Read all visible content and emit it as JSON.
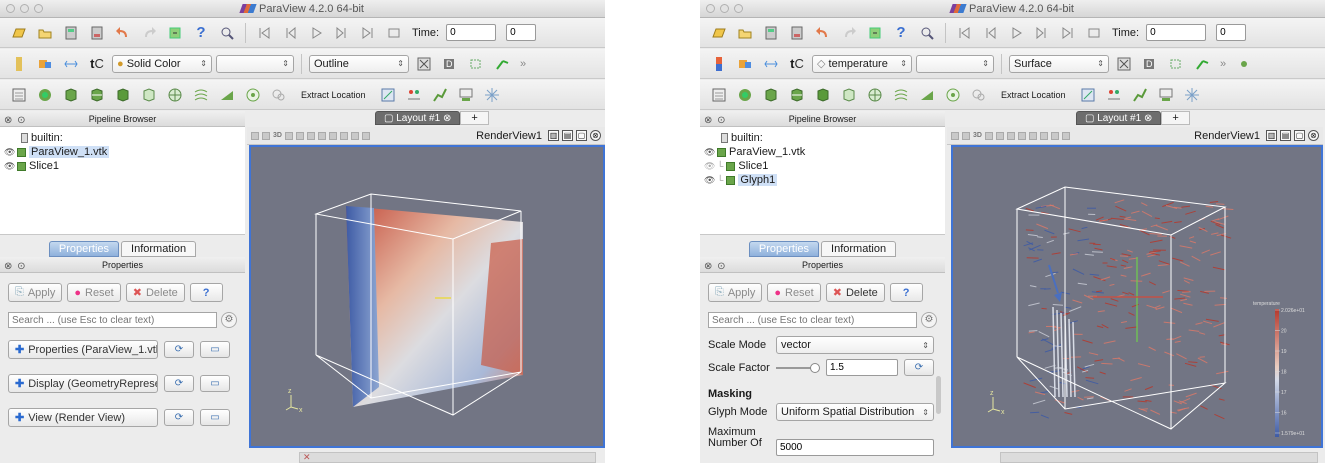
{
  "app_title": "ParaView 4.2.0 64-bit",
  "time": {
    "label": "Time:",
    "value": "0",
    "step_value": "0"
  },
  "extract_location": "Extract Location",
  "left_window": {
    "color_by": "Solid Color",
    "representation": "Outline",
    "pipeline_title": "Pipeline Browser",
    "pipeline": [
      {
        "label": "builtin:",
        "kind": "server"
      },
      {
        "label": "ParaView_1.vtk",
        "kind": "source",
        "selected": true
      },
      {
        "label": "Slice1",
        "kind": "filter"
      }
    ],
    "layout_tab": "Layout #1",
    "add_tab": "+",
    "render_view": "RenderView1",
    "properties_tab": "Properties",
    "information_tab": "Information",
    "properties_title": "Properties",
    "apply": "Apply",
    "reset": "Reset",
    "delete": "Delete",
    "help": "?",
    "search_placeholder": "Search ... (use Esc to clear text)",
    "sections": [
      {
        "label": "Properties (ParaView_1.vtk"
      },
      {
        "label": "Display (GeometryReprese"
      },
      {
        "label": "View (Render View)"
      }
    ]
  },
  "right_window": {
    "color_by": "temperature",
    "representation": "Surface",
    "pipeline_title": "Pipeline Browser",
    "pipeline": [
      {
        "label": "builtin:",
        "kind": "server"
      },
      {
        "label": "ParaView_1.vtk",
        "kind": "source"
      },
      {
        "label": "Slice1",
        "kind": "filter"
      },
      {
        "label": "Glyph1",
        "kind": "filter",
        "selected": true
      }
    ],
    "layout_tab": "Layout #1",
    "add_tab": "+",
    "render_view": "RenderView1",
    "properties_tab": "Properties",
    "information_tab": "Information",
    "properties_title": "Properties",
    "apply": "Apply",
    "reset": "Reset",
    "delete": "Delete",
    "help": "?",
    "search_placeholder": "Search ... (use Esc to clear text)",
    "scale_mode_label": "Scale Mode",
    "scale_mode_value": "vector",
    "scale_factor_label": "Scale Factor",
    "scale_factor_value": "1.5",
    "masking_label": "Masking",
    "glyph_mode_label": "Glyph Mode",
    "glyph_mode_value": "Uniform Spatial Distribution",
    "max_points_label_1": "Maximum",
    "max_points_label_2": "Number Of",
    "max_points_value": "5000",
    "legend": {
      "title": "temperature",
      "ticks": [
        "2.026e+01",
        "20",
        "19",
        "18",
        "17",
        "16",
        "1.579e+01"
      ]
    }
  },
  "colors": {
    "render_bg": "#727584",
    "view_border": "#3f74d6",
    "hot": "#b5382c",
    "cold": "#3e5ba5",
    "selection": "#cfe0f6"
  }
}
